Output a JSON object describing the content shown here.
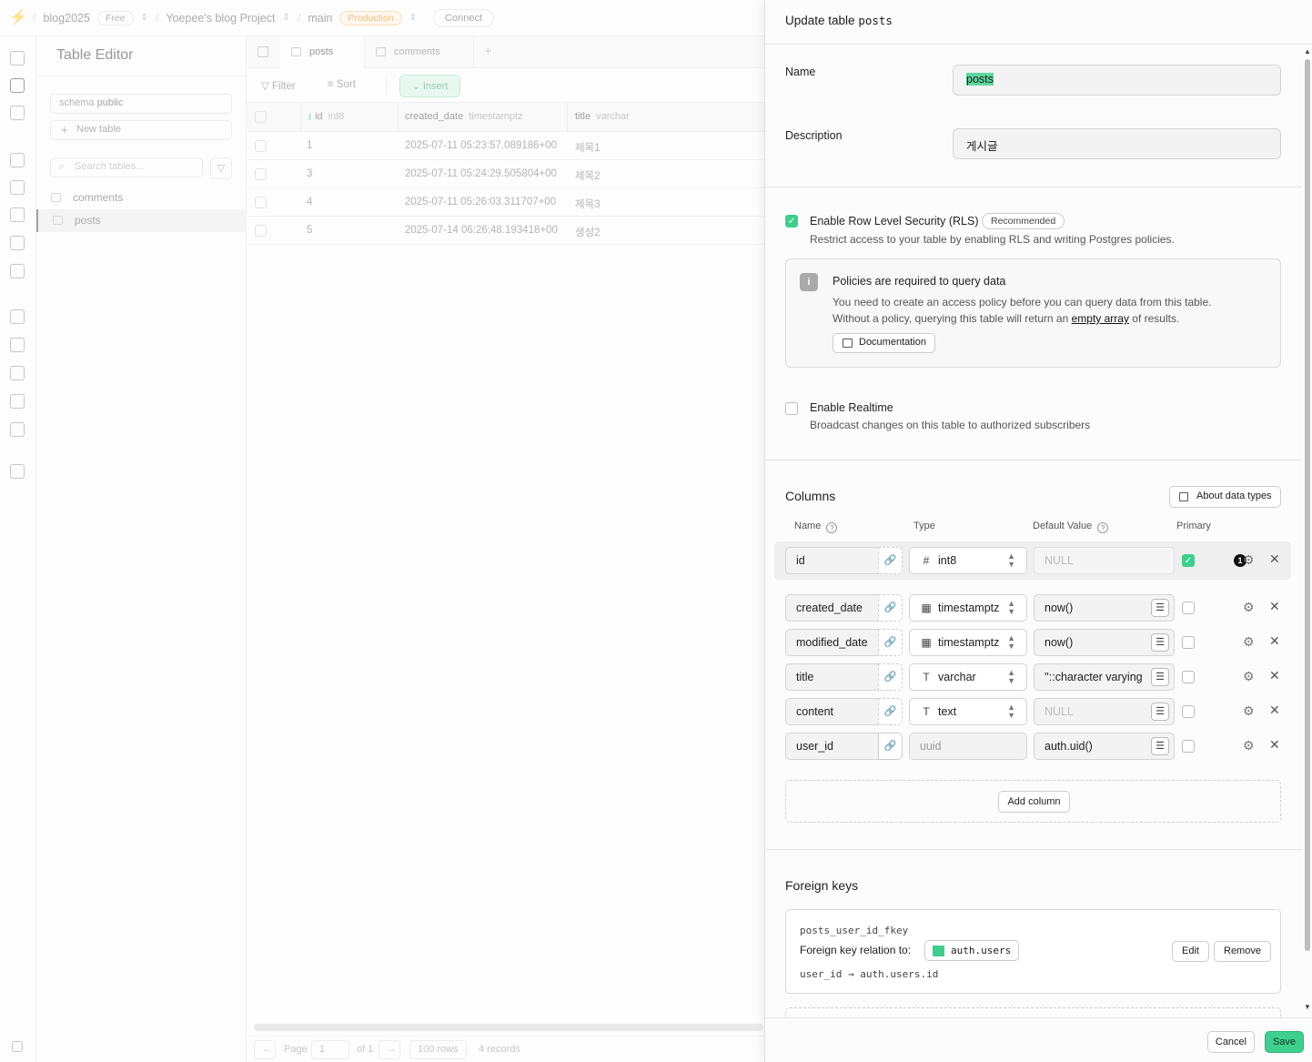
{
  "topbar": {
    "org": "blog2025",
    "org_plan": "Free",
    "project": "Yoepee's blog Project",
    "branch": "main",
    "branch_env": "Production",
    "connect": "Connect"
  },
  "sidebar": {
    "title": "Table Editor",
    "schema_label": "schema",
    "schema_value": "public",
    "new_table": "New table",
    "search_placeholder": "Search tables...",
    "tables": [
      {
        "label": "comments"
      },
      {
        "label": "posts"
      }
    ]
  },
  "grid": {
    "tabs": [
      {
        "label": "posts"
      },
      {
        "label": "comments"
      }
    ],
    "toolbar": {
      "filter": "Filter",
      "sort": "Sort",
      "insert": "Insert"
    },
    "columns": [
      {
        "name": "id",
        "type": "int8"
      },
      {
        "name": "created_date",
        "type": "timestamptz"
      },
      {
        "name": "title",
        "type": "varchar"
      }
    ],
    "rows": [
      {
        "id": "1",
        "created_date": "2025-07-11 05:23:57.089186+00",
        "title": "제목1"
      },
      {
        "id": "3",
        "created_date": "2025-07-11 05:24:29.505804+00",
        "title": "제목2"
      },
      {
        "id": "4",
        "created_date": "2025-07-11 05:26:03.311707+00",
        "title": "제목3"
      },
      {
        "id": "5",
        "created_date": "2025-07-14 06:26:48.193418+00",
        "title": "생성2"
      }
    ],
    "footer": {
      "page_label": "Page",
      "page_value": "1",
      "of_pages": "of 1",
      "rows_per_page": "100 rows",
      "records": "4 records"
    }
  },
  "panel": {
    "title_prefix": "Update table",
    "title_table": "posts",
    "name_label": "Name",
    "name_value": "posts",
    "description_label": "Description",
    "description_value": "게시글",
    "rls": {
      "label": "Enable Row Level Security (RLS)",
      "badge": "Recommended",
      "checked": true,
      "description": "Restrict access to your table by enabling RLS and writing Postgres policies."
    },
    "policy_notice": {
      "title": "Policies are required to query data",
      "line1": "You need to create an access policy before you can query data from this table.",
      "line2_before": "Without a policy, querying this table will return an",
      "line2_link": "empty array",
      "line2_after": "of results.",
      "doc_button": "Documentation"
    },
    "realtime": {
      "label": "Enable Realtime",
      "checked": false,
      "description": "Broadcast changes on this table to authorized subscribers"
    },
    "columns_section": {
      "title": "Columns",
      "about_button": "About data types",
      "headers": {
        "name": "Name",
        "type": "Type",
        "default": "Default Value",
        "primary": "Primary"
      },
      "rows": [
        {
          "name": "id",
          "type": "int8",
          "type_icon": "hash-icon",
          "default": "NULL",
          "default_is_placeholder": true,
          "primary": true,
          "badge": "1"
        },
        {
          "name": "created_date",
          "type": "timestamptz",
          "type_icon": "calendar-icon",
          "default": "now()",
          "default_is_placeholder": false,
          "primary": false
        },
        {
          "name": "modified_date",
          "type": "timestamptz",
          "type_icon": "calendar-icon",
          "default": "now()",
          "default_is_placeholder": false,
          "primary": false
        },
        {
          "name": "title",
          "type": "varchar",
          "type_icon": "text-type-icon",
          "default": "''::character varying",
          "default_is_placeholder": false,
          "primary": false
        },
        {
          "name": "content",
          "type": "text",
          "type_icon": "text-type-icon",
          "default": "NULL",
          "default_is_placeholder": true,
          "primary": false
        },
        {
          "name": "user_id",
          "type": "uuid",
          "type_icon": "",
          "default": "auth.uid()",
          "default_is_placeholder": false,
          "primary": false
        }
      ],
      "add_column": "Add column"
    },
    "foreign_keys": {
      "title": "Foreign keys",
      "constraint_name": "posts_user_id_fkey",
      "relation_label": "Foreign key relation to:",
      "relation_table": "auth.users",
      "source_column": "user_id",
      "target_column": "auth.users.id",
      "edit": "Edit",
      "remove": "Remove"
    },
    "cancel": "Cancel",
    "save": "Save"
  },
  "colors": {
    "accent": "#3ecf8e",
    "production_badge": "#d98a1a"
  }
}
